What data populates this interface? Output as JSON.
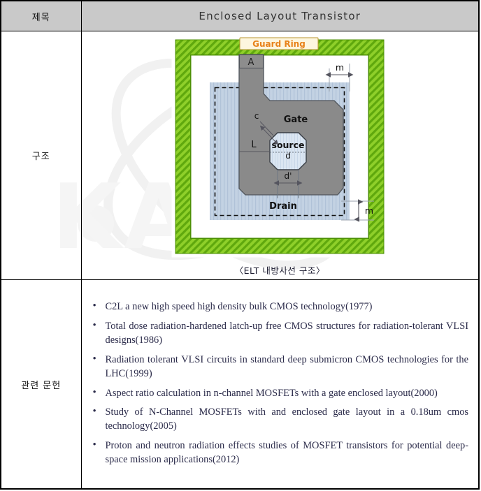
{
  "table": {
    "header": {
      "label": "제목",
      "title": "Enclosed Layout Transistor"
    },
    "rows": [
      {
        "label": "구조"
      },
      {
        "label": "관련 문헌"
      }
    ]
  },
  "figure": {
    "caption": "〈ELT 내방사선 구조〉",
    "labels": {
      "guard_ring": "Guard Ring",
      "contact_a": "A",
      "gate": "Gate",
      "source": "source",
      "drain": "Drain",
      "dim_c": "c",
      "dim_L": "L",
      "dim_d": "d",
      "dim_d_prime": "d'",
      "dim_m_top": "m",
      "dim_m_bottom": "m"
    },
    "colors": {
      "guard_ring_green": "#7ac420",
      "gate_gray": "#8a8a8a",
      "diffusion_blue": "#c3d2e3",
      "source_fill": "#d5e2ef",
      "guard_ring_label_text": "#e8821a",
      "outline": "#555555"
    }
  },
  "references": {
    "items": [
      "C2L a new high speed high density bulk CMOS technology(1977)",
      "Total dose radiation-hardened latch-up free CMOS structures for radiation-tolerant VLSI designs(1986)",
      "Radiation tolerant VLSI circuits in standard deep submicron CMOS technologies for the LHC(1999)",
      "Aspect ratio calculation in n-channel MOSFETs with a gate enclosed layout(2000)",
      "Study of N-Channel MOSFETs with and enclosed gate layout in a 0.18um cmos technology(2005)",
      "Proton and neutron radiation effects studies of MOSFET transistors for potential deep-space mission applications(2012)"
    ]
  },
  "watermark": {
    "text": "KAERI"
  }
}
